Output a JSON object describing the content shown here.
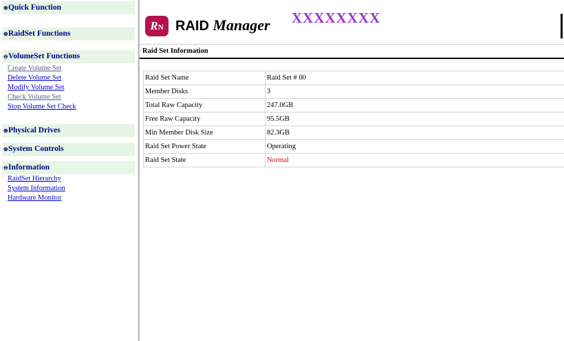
{
  "nav": {
    "sections": [
      {
        "label": "Quick Function"
      },
      {
        "label": "RaidSet Functions"
      },
      {
        "label": "VolumeSet Functions"
      },
      {
        "label": "Physical Drives"
      },
      {
        "label": "System Controls"
      },
      {
        "label": "Information"
      }
    ],
    "volume_links": [
      "Create Volume Set",
      "Delete Volume Set",
      "Modify Volume Set",
      "Check Volume Set",
      "Stop Volume Set Check"
    ],
    "info_links": [
      "RaidSet Hierarchy",
      "System Information",
      "Hardware Monitor"
    ]
  },
  "banner": {
    "logo_text": "R",
    "logo_sub": "N",
    "title_plain": "RAID ",
    "title_script": "Manager",
    "model": "XXXXXXXX"
  },
  "section_title": "Raid Set Information",
  "raid_info": [
    {
      "label": "Raid Set Name",
      "value": "Raid Set # 00"
    },
    {
      "label": "Member Disks",
      "value": "3"
    },
    {
      "label": "Total Raw Capacity",
      "value": "247.0GB"
    },
    {
      "label": "Free Raw Capacity",
      "value": "95.5GB"
    },
    {
      "label": "Min Member Disk Size",
      "value": "82.3GB"
    },
    {
      "label": "Raid Set Power State",
      "value": "Operating"
    },
    {
      "label": "Raid Set State",
      "value": "Normal"
    }
  ],
  "colors": {
    "nav_header_bg": "#e6f5e6",
    "nav_header_text": "#000080",
    "link": "#0000cc",
    "logo": "#b5124f",
    "model": "#9933cc",
    "status_normal": "#e00000"
  }
}
